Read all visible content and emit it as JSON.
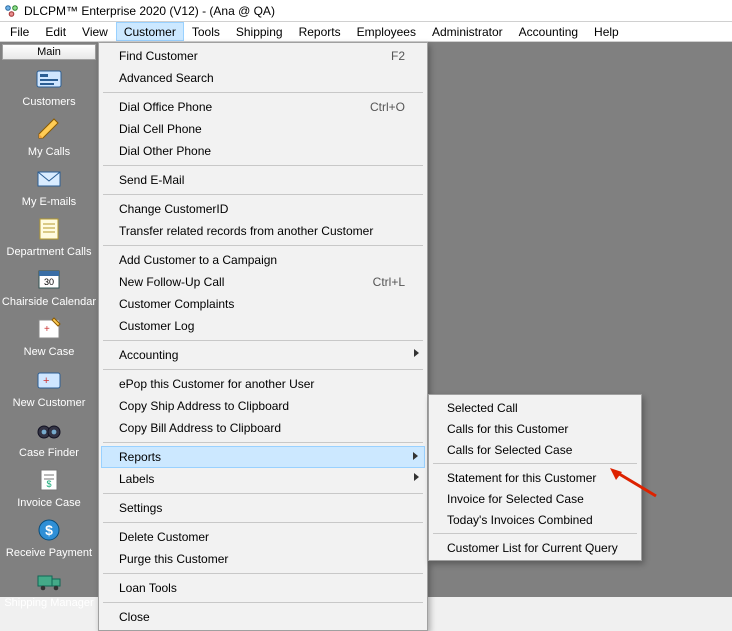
{
  "window": {
    "title": "DLCPM™ Enterprise 2020 (V12) - (Ana @ QA)"
  },
  "menubar": [
    "File",
    "Edit",
    "View",
    "Customer",
    "Tools",
    "Shipping",
    "Reports",
    "Employees",
    "Administrator",
    "Accounting",
    "Help"
  ],
  "menubar_active_index": 3,
  "sidebar_tab": "Main",
  "sidebar_items": [
    {
      "label": "Customers",
      "icon": "customers-icon"
    },
    {
      "label": "My Calls",
      "icon": "mycalls-icon"
    },
    {
      "label": "My E-mails",
      "icon": "myemails-icon"
    },
    {
      "label": "Department Calls",
      "icon": "deptcalls-icon"
    },
    {
      "label": "Chairside Calendar",
      "icon": "calendar-icon"
    },
    {
      "label": "New Case",
      "icon": "newcase-icon"
    },
    {
      "label": "New Customer",
      "icon": "newcustomer-icon"
    },
    {
      "label": "Case Finder",
      "icon": "casefinder-icon"
    },
    {
      "label": "Invoice Case",
      "icon": "invoicecase-icon"
    },
    {
      "label": "Receive Payment",
      "icon": "receivepayment-icon"
    },
    {
      "label": "Shipping Manager",
      "icon": "shippingmanager-icon"
    }
  ],
  "customer_menu": {
    "groups": [
      [
        {
          "label": "Find Customer",
          "shortcut": "F2"
        },
        {
          "label": "Advanced Search"
        }
      ],
      [
        {
          "label": "Dial Office Phone",
          "shortcut": "Ctrl+O"
        },
        {
          "label": "Dial Cell Phone"
        },
        {
          "label": "Dial Other Phone"
        }
      ],
      [
        {
          "label": "Send E-Mail"
        }
      ],
      [
        {
          "label": "Change CustomerID"
        },
        {
          "label": "Transfer related records from another Customer"
        }
      ],
      [
        {
          "label": "Add Customer to a Campaign"
        },
        {
          "label": "New Follow-Up Call",
          "shortcut": "Ctrl+L"
        },
        {
          "label": "Customer Complaints"
        },
        {
          "label": "Customer Log"
        }
      ],
      [
        {
          "label": "Accounting",
          "submenu": true
        }
      ],
      [
        {
          "label": "ePop this Customer for another User"
        },
        {
          "label": "Copy Ship Address to Clipboard"
        },
        {
          "label": "Copy Bill Address to Clipboard"
        }
      ],
      [
        {
          "label": "Reports",
          "submenu": true,
          "highlight": true
        },
        {
          "label": "Labels",
          "submenu": true
        }
      ],
      [
        {
          "label": "Settings"
        }
      ],
      [
        {
          "label": "Delete Customer"
        },
        {
          "label": "Purge this Customer"
        }
      ],
      [
        {
          "label": "Loan Tools"
        }
      ],
      [
        {
          "label": "Close"
        }
      ]
    ]
  },
  "reports_submenu": {
    "groups": [
      [
        "Selected Call",
        "Calls for this Customer",
        "Calls for Selected Case"
      ],
      [
        "Statement for this Customer",
        "Invoice for Selected Case",
        "Today's Invoices Combined"
      ],
      [
        "Customer List for Current Query"
      ]
    ]
  }
}
